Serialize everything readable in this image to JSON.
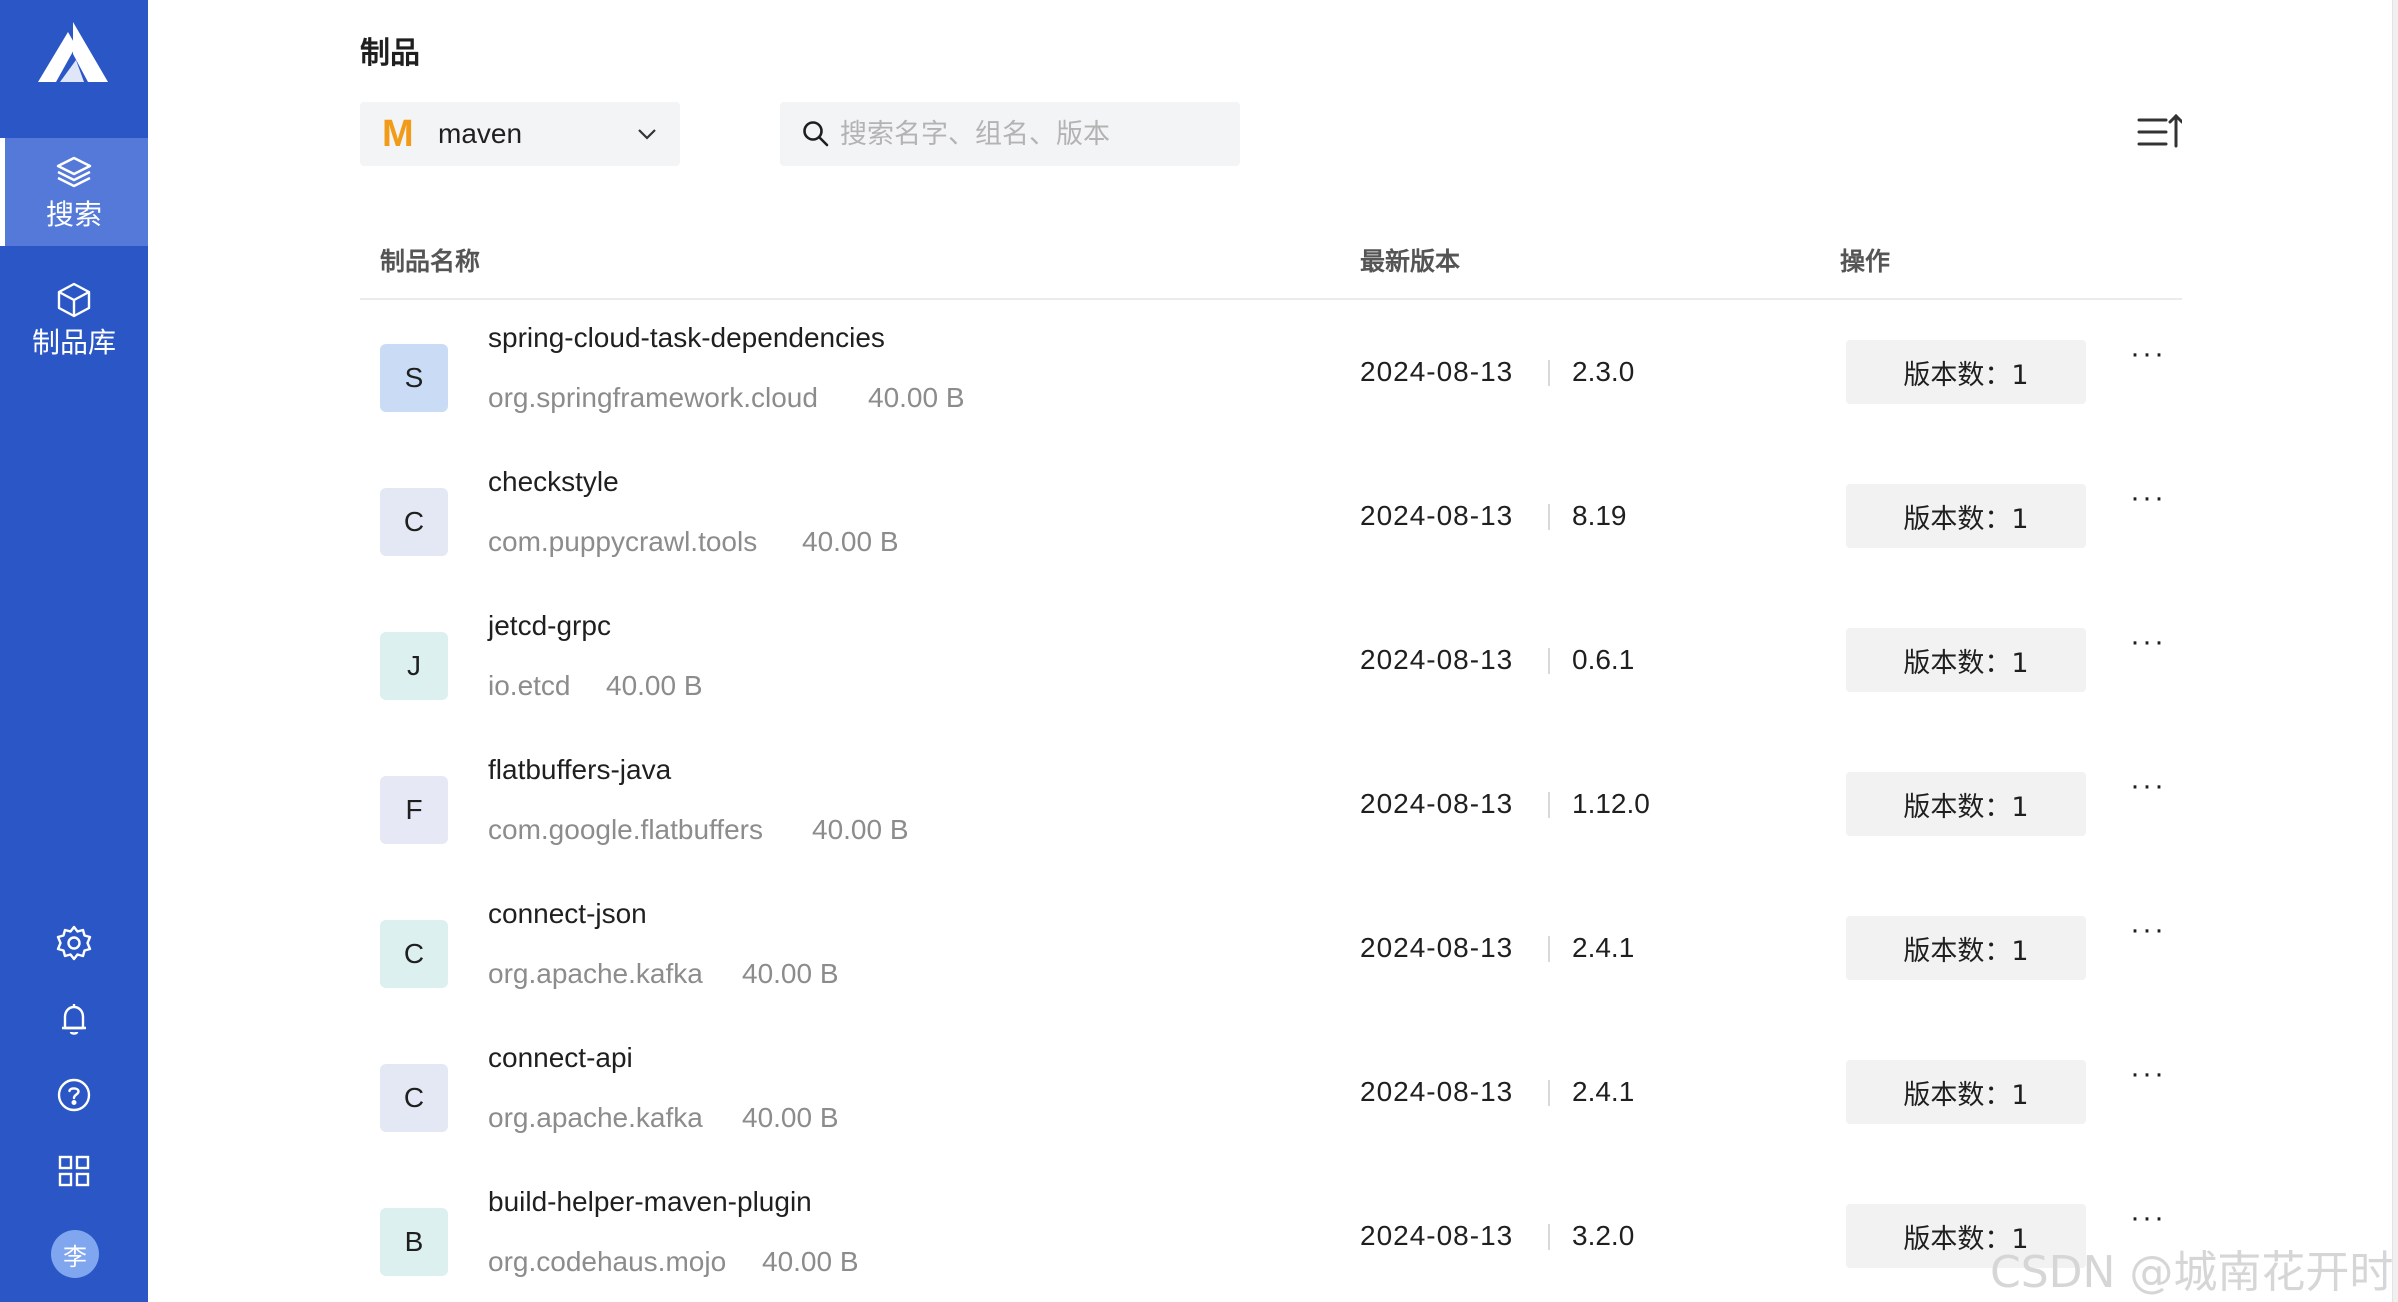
{
  "sidebar": {
    "nav": [
      {
        "label": "搜索",
        "icon": "layers-icon",
        "active": true
      },
      {
        "label": "制品库",
        "icon": "cube-icon",
        "active": false
      }
    ],
    "bottom_icons": [
      "settings-icon",
      "bell-icon",
      "help-icon",
      "apps-grid-icon"
    ],
    "avatar_text": "李"
  },
  "page": {
    "title": "制品"
  },
  "filter": {
    "repo_icon_letter": "M",
    "repo_icon_color": "#f29b18",
    "repo_selected": "maven",
    "search_placeholder": "搜索名字、组名、版本"
  },
  "table": {
    "columns": {
      "name": "制品名称",
      "latest": "最新版本",
      "action": "操作"
    },
    "rows": [
      {
        "badge": "S",
        "badge_color": "#c9dbf5",
        "name": "spring-cloud-task-dependencies",
        "group": "org.springframework.cloud",
        "size": "40.00 B",
        "date": "2024-08-13",
        "version": "2.3.0",
        "versions_label": "版本数：1"
      },
      {
        "badge": "C",
        "badge_color": "#e4e8f4",
        "name": "checkstyle",
        "group": "com.puppycrawl.tools",
        "size": "40.00 B",
        "date": "2024-08-13",
        "version": "8.19",
        "versions_label": "版本数：1"
      },
      {
        "badge": "J",
        "badge_color": "#dcf0ef",
        "name": "jetcd-grpc",
        "group": "io.etcd",
        "size": "40.00 B",
        "date": "2024-08-13",
        "version": "0.6.1",
        "versions_label": "版本数：1"
      },
      {
        "badge": "F",
        "badge_color": "#e6e8f5",
        "name": "flatbuffers-java",
        "group": "com.google.flatbuffers",
        "size": "40.00 B",
        "date": "2024-08-13",
        "version": "1.12.0",
        "versions_label": "版本数：1"
      },
      {
        "badge": "C",
        "badge_color": "#dcf0ef",
        "name": "connect-json",
        "group": "org.apache.kafka",
        "size": "40.00 B",
        "date": "2024-08-13",
        "version": "2.4.1",
        "versions_label": "版本数：1"
      },
      {
        "badge": "C",
        "badge_color": "#e4e8f4",
        "name": "connect-api",
        "group": "org.apache.kafka",
        "size": "40.00 B",
        "date": "2024-08-13",
        "version": "2.4.1",
        "versions_label": "版本数：1"
      },
      {
        "badge": "B",
        "badge_color": "#dcf0ef",
        "name": "build-helper-maven-plugin",
        "group": "org.codehaus.mojo",
        "size": "40.00 B",
        "date": "2024-08-13",
        "version": "3.2.0",
        "versions_label": "版本数：1"
      }
    ],
    "more_label": "···"
  },
  "watermark": "CSDN @城南花开时",
  "colors": {
    "sidebar": "#2a56c6",
    "sidebar_active": "#5479d8",
    "accent": "#f29b18"
  }
}
